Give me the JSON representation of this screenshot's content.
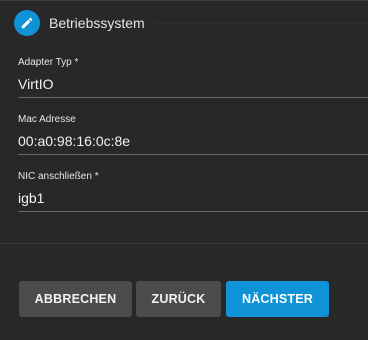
{
  "step": {
    "title": "Betriebssystem",
    "icon": "pencil-icon"
  },
  "fields": [
    {
      "label": "Adapter Typ *",
      "value": "VirtIO"
    },
    {
      "label": "Mac Adresse",
      "value": "00:a0:98:16:0c:8e"
    },
    {
      "label": "NIC anschließen *",
      "value": "igb1"
    }
  ],
  "buttons": {
    "cancel": "ABBRECHEN",
    "back": "ZURÜCK",
    "next": "NÄCHSTER"
  },
  "colors": {
    "accent": "#0f93d6",
    "background": "#282828",
    "secondary_button": "#4c4c4c"
  }
}
